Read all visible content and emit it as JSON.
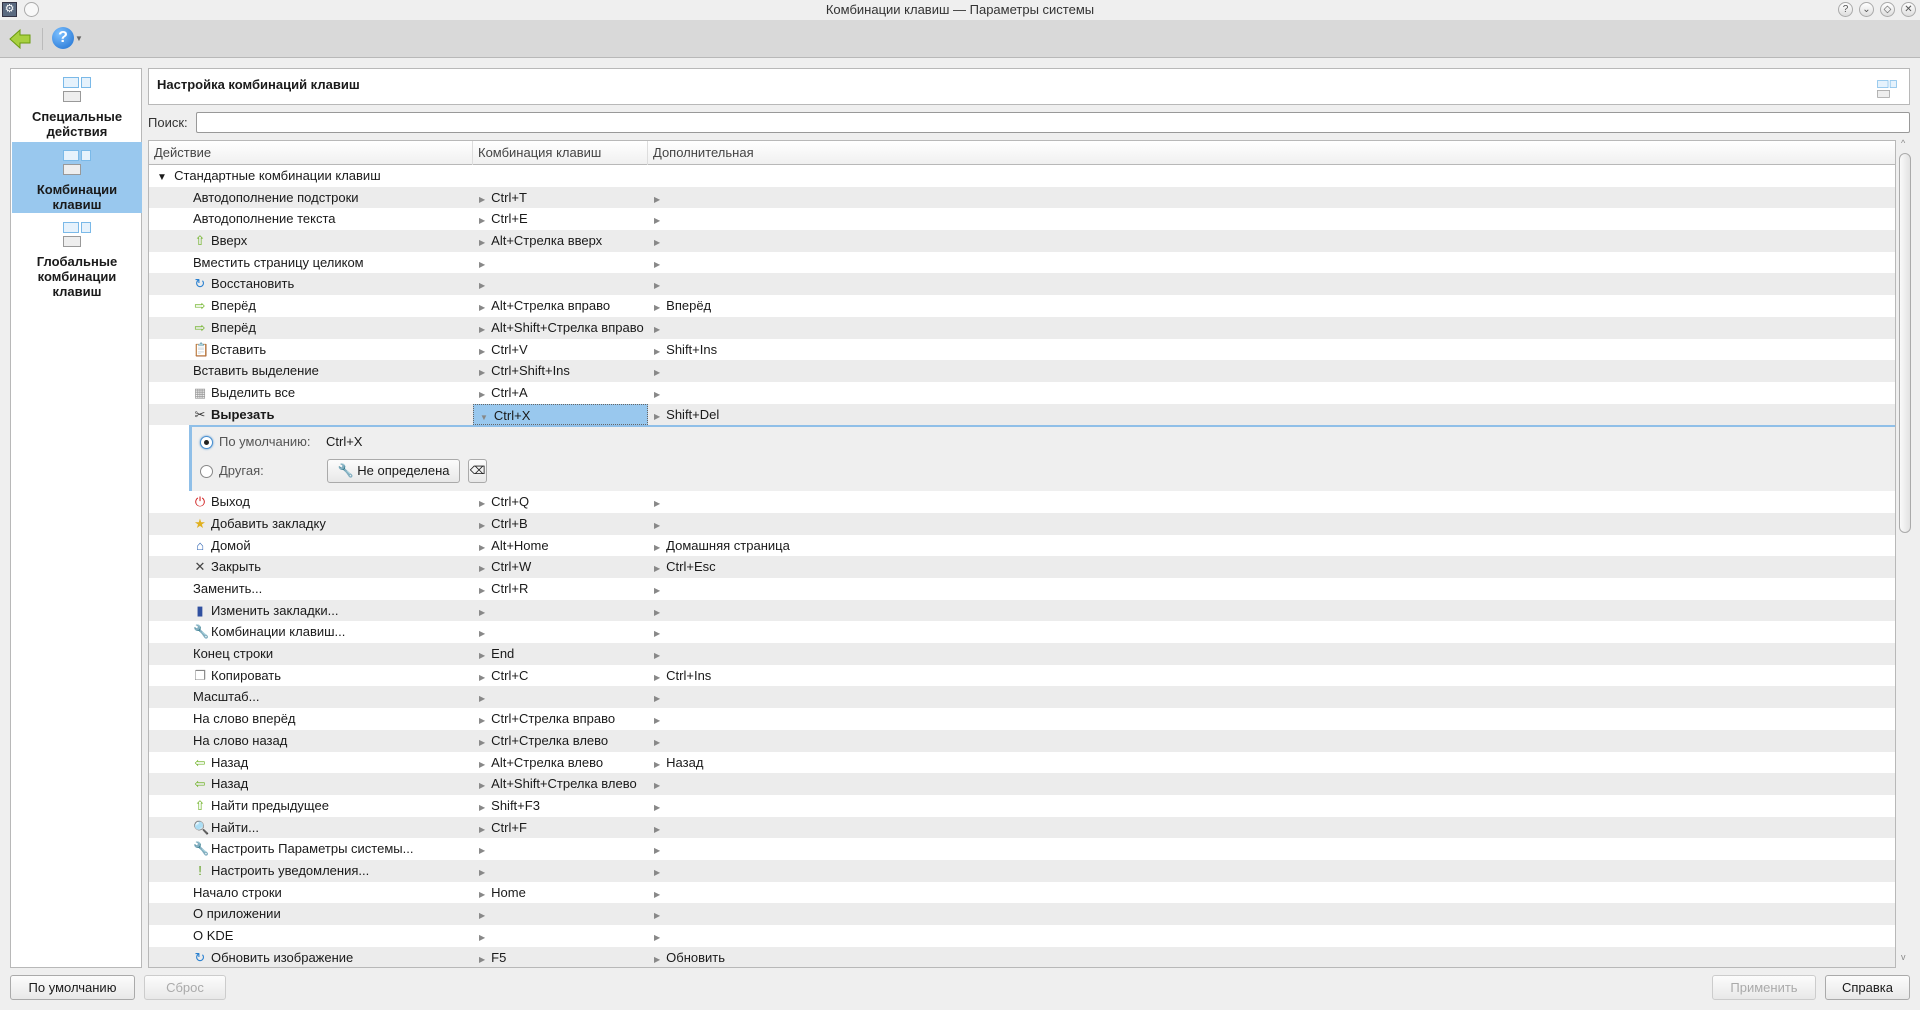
{
  "window": {
    "title": "Комбинации клавиш — Параметры системы",
    "buttons": [
      "?",
      "⌄",
      "◇",
      "✕"
    ]
  },
  "toolbar": {
    "back": "back-icon",
    "help": "?"
  },
  "sidebar": {
    "items": [
      {
        "label": "Специальные действия",
        "selected": false
      },
      {
        "label": "Комбинации клавиш",
        "selected": true
      },
      {
        "label": "Глобальные комбинации клавиш",
        "selected": false
      }
    ]
  },
  "header": {
    "title": "Настройка комбинаций клавиш"
  },
  "search": {
    "label": "Поиск:",
    "value": "",
    "placeholder": ""
  },
  "table": {
    "columns": [
      "Действие",
      "Комбинация клавиш",
      "Дополнительная"
    ],
    "group": "Стандартные комбинации клавиш",
    "rows_before": [
      {
        "action": "Автодополнение подстроки",
        "icon": "",
        "shortcut": "Ctrl+T",
        "alt": ""
      },
      {
        "action": "Автодополнение текста",
        "icon": "",
        "shortcut": "Ctrl+E",
        "alt": ""
      },
      {
        "action": "Вверх",
        "icon": "up-arrow",
        "shortcut": "Alt+Стрелка вверх",
        "alt": ""
      },
      {
        "action": "Вместить страницу целиком",
        "icon": "",
        "shortcut": "",
        "alt": ""
      },
      {
        "action": "Восстановить",
        "icon": "redo",
        "shortcut": "",
        "alt": ""
      },
      {
        "action": "Вперёд",
        "icon": "right-arrow",
        "shortcut": "Alt+Стрелка вправо",
        "alt": "Вперёд"
      },
      {
        "action": "Вперёд",
        "icon": "right-arrow",
        "shortcut": "Alt+Shift+Стрелка вправо",
        "alt": ""
      },
      {
        "action": "Вставить",
        "icon": "paste",
        "shortcut": "Ctrl+V",
        "alt": "Shift+Ins"
      },
      {
        "action": "Вставить выделение",
        "icon": "",
        "shortcut": "Ctrl+Shift+Ins",
        "alt": ""
      },
      {
        "action": "Выделить все",
        "icon": "select-all",
        "shortcut": "Ctrl+A",
        "alt": ""
      },
      {
        "action": "Вырезать",
        "icon": "scissors",
        "shortcut": "Ctrl+X",
        "alt": "Shift+Del",
        "selected": true
      }
    ],
    "editor": {
      "default_label": "По умолчанию:",
      "default_value": "Ctrl+X",
      "other_label": "Другая:",
      "other_button": "Не определена"
    },
    "rows_after": [
      {
        "action": "Выход",
        "icon": "quit",
        "shortcut": "Ctrl+Q",
        "alt": ""
      },
      {
        "action": "Добавить закладку",
        "icon": "bookmark-star",
        "shortcut": "Ctrl+B",
        "alt": ""
      },
      {
        "action": "Домой",
        "icon": "home",
        "shortcut": "Alt+Home",
        "alt": "Домашняя страница"
      },
      {
        "action": "Закрыть",
        "icon": "close",
        "shortcut": "Ctrl+W",
        "alt": "Ctrl+Esc"
      },
      {
        "action": "Заменить...",
        "icon": "",
        "shortcut": "Ctrl+R",
        "alt": ""
      },
      {
        "action": "Изменить закладки...",
        "icon": "bookmarks",
        "shortcut": "",
        "alt": ""
      },
      {
        "action": "Комбинации клавиш...",
        "icon": "configure",
        "shortcut": "",
        "alt": ""
      },
      {
        "action": "Конец строки",
        "icon": "",
        "shortcut": "End",
        "alt": ""
      },
      {
        "action": "Копировать",
        "icon": "copy",
        "shortcut": "Ctrl+C",
        "alt": "Ctrl+Ins"
      },
      {
        "action": "Масштаб...",
        "icon": "",
        "shortcut": "",
        "alt": ""
      },
      {
        "action": "На слово вперёд",
        "icon": "",
        "shortcut": "Ctrl+Стрелка вправо",
        "alt": ""
      },
      {
        "action": "На слово назад",
        "icon": "",
        "shortcut": "Ctrl+Стрелка влево",
        "alt": ""
      },
      {
        "action": "Назад",
        "icon": "left-arrow",
        "shortcut": "Alt+Стрелка влево",
        "alt": "Назад"
      },
      {
        "action": "Назад",
        "icon": "left-arrow",
        "shortcut": "Alt+Shift+Стрелка влево",
        "alt": ""
      },
      {
        "action": "Найти предыдущее",
        "icon": "up-arrow",
        "shortcut": "Shift+F3",
        "alt": ""
      },
      {
        "action": "Найти...",
        "icon": "search",
        "shortcut": "Ctrl+F",
        "alt": ""
      },
      {
        "action": "Настроить Параметры системы...",
        "icon": "configure",
        "shortcut": "",
        "alt": ""
      },
      {
        "action": "Настроить уведомления...",
        "icon": "notification",
        "shortcut": "",
        "alt": ""
      },
      {
        "action": "Начало строки",
        "icon": "",
        "shortcut": "Home",
        "alt": ""
      },
      {
        "action": "О приложении",
        "icon": "",
        "shortcut": "",
        "alt": ""
      },
      {
        "action": "О KDE",
        "icon": "",
        "shortcut": "",
        "alt": ""
      },
      {
        "action": "Обновить изображение",
        "icon": "redo",
        "shortcut": "F5",
        "alt": "Обновить"
      }
    ]
  },
  "footer": {
    "defaults": "По умолчанию",
    "reset": "Сброс",
    "apply": "Применить",
    "help": "Справка"
  }
}
